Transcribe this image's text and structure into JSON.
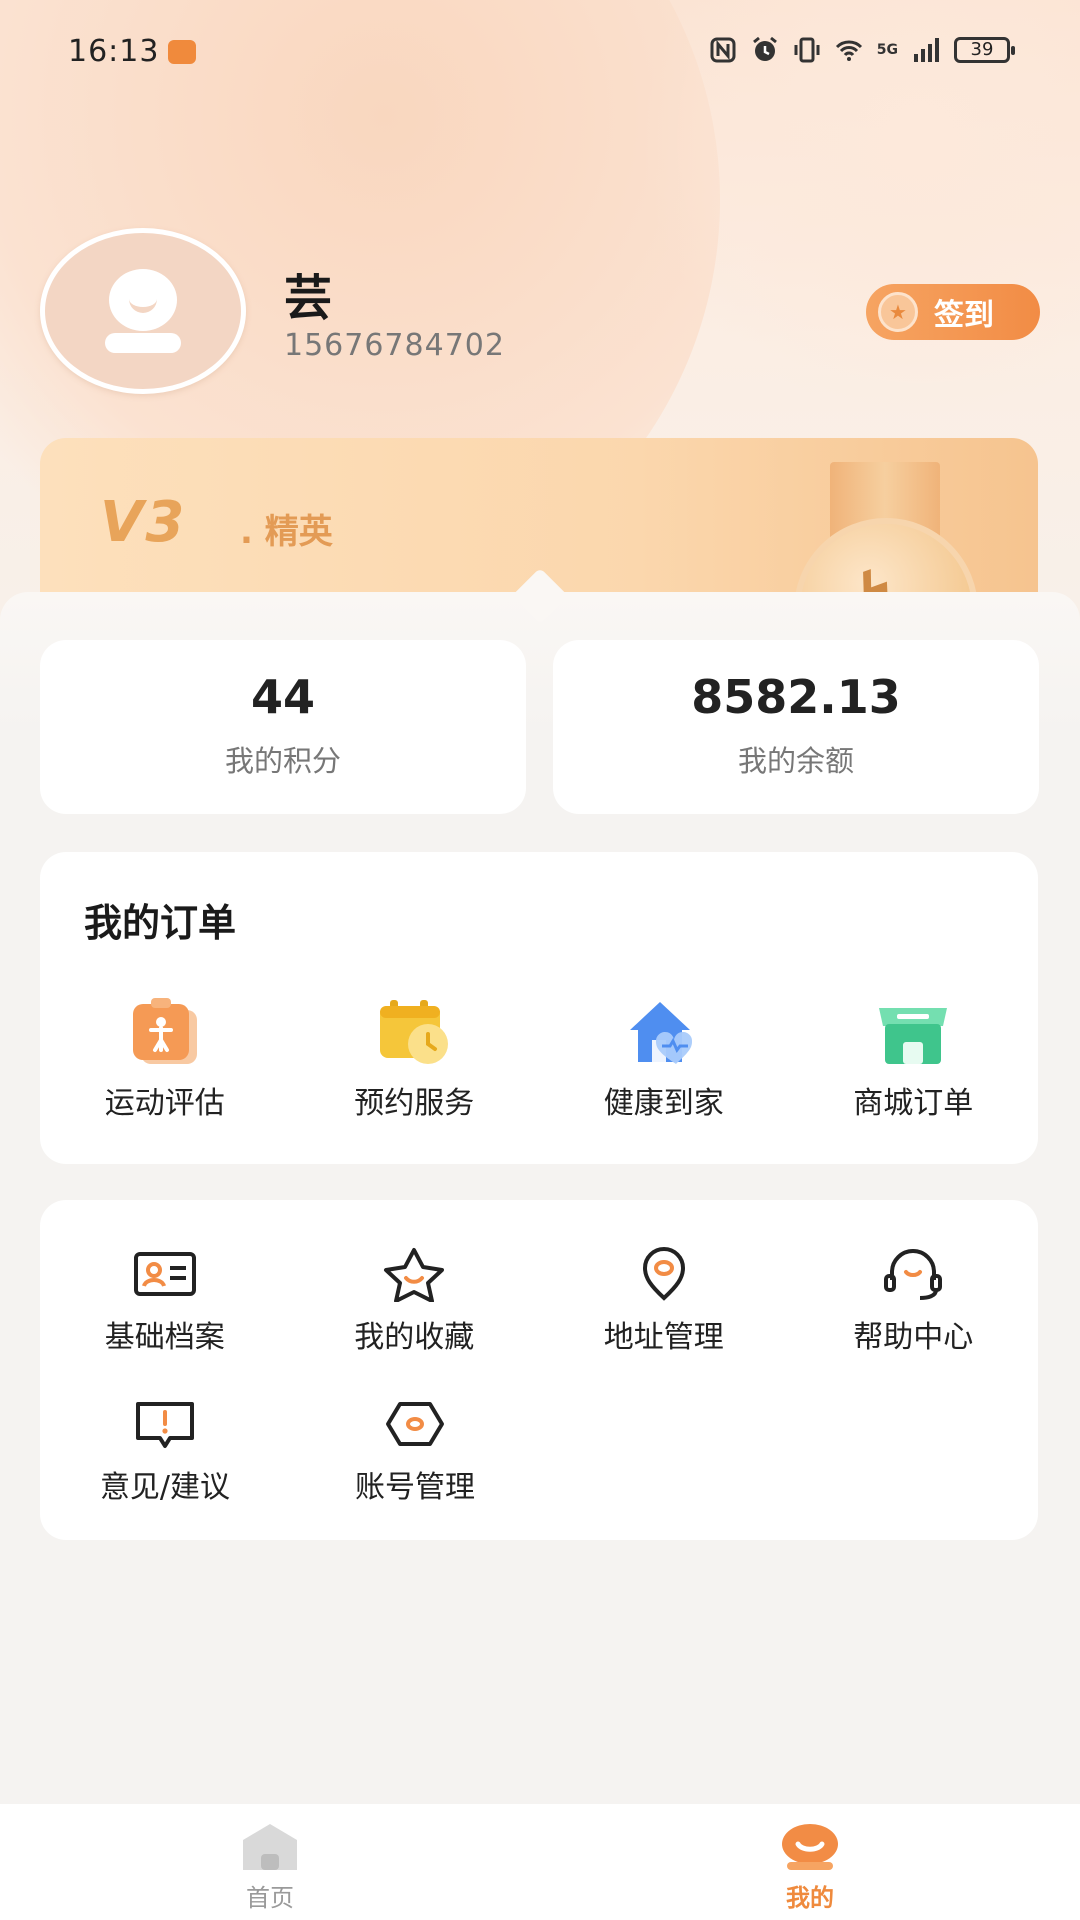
{
  "status_bar": {
    "time": "16:13",
    "network": "5G",
    "battery": "39"
  },
  "profile": {
    "name": "芸",
    "phone": "15676784702",
    "signin_label": "签到"
  },
  "vip": {
    "level": "V3",
    "title": ". 精英"
  },
  "stats": [
    {
      "value": "44",
      "label": "我的积分"
    },
    {
      "value": "8582.13",
      "label": "我的余额"
    }
  ],
  "orders": {
    "title": "我的订单",
    "items": [
      {
        "label": "运动评估",
        "icon": "sport-assessment-icon",
        "color": "#f59a55"
      },
      {
        "label": "预约服务",
        "icon": "calendar-clock-icon",
        "color": "#f5c63a"
      },
      {
        "label": "健康到家",
        "icon": "home-health-icon",
        "color": "#4f8ef0"
      },
      {
        "label": "商城订单",
        "icon": "shop-icon",
        "color": "#3fc58c"
      }
    ]
  },
  "tools": {
    "items": [
      {
        "label": "基础档案",
        "icon": "id-card-icon"
      },
      {
        "label": "我的收藏",
        "icon": "star-icon"
      },
      {
        "label": "地址管理",
        "icon": "location-pin-icon"
      },
      {
        "label": "帮助中心",
        "icon": "headset-icon"
      },
      {
        "label": "意见/建议",
        "icon": "feedback-icon"
      },
      {
        "label": "账号管理",
        "icon": "settings-hexagon-icon"
      }
    ]
  },
  "tab_bar": {
    "tabs": [
      {
        "label": "首页",
        "icon": "home-icon",
        "active": false
      },
      {
        "label": "我的",
        "icon": "mine-icon",
        "active": true
      }
    ],
    "active_color": "#ef8a3d"
  },
  "colors": {
    "accent": "#f28c45",
    "page_bg": "#f5f3f1"
  }
}
